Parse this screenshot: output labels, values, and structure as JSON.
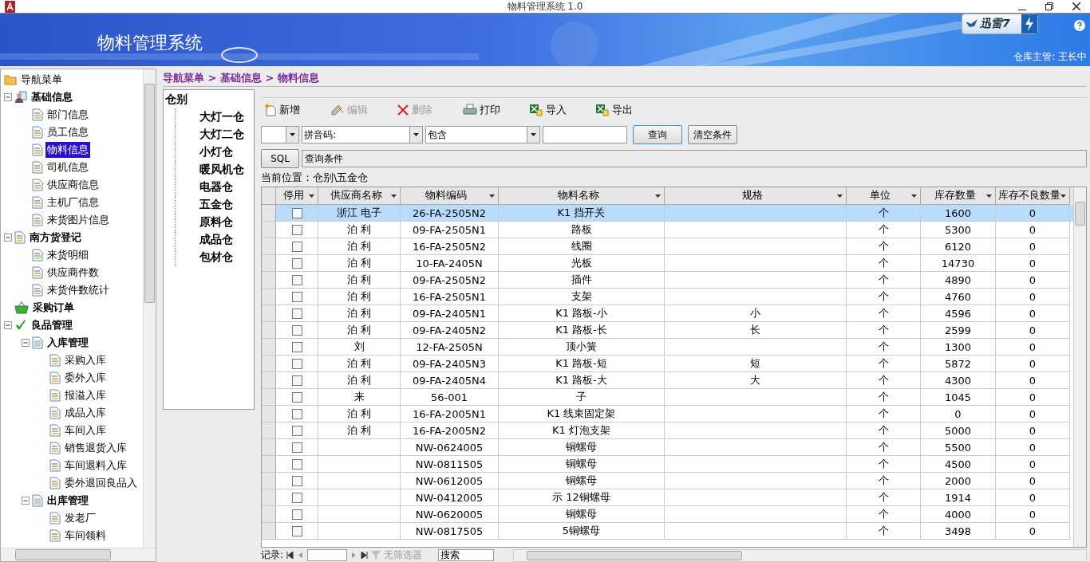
{
  "window": {
    "title": "物料管理系统 1.0"
  },
  "banner": {
    "title": "物料管理系统",
    "badge": "迅雷7",
    "user": "仓库主管: 王长中"
  },
  "nav": {
    "root": "导航菜单",
    "items": [
      {
        "label": "基础信息",
        "kind": "person",
        "expanded": true,
        "selected": false,
        "children": [
          {
            "label": "部门信息",
            "kind": "page",
            "selected": false
          },
          {
            "label": "员工信息",
            "kind": "page",
            "selected": false
          },
          {
            "label": "物料信息",
            "kind": "page",
            "selected": true
          },
          {
            "label": "司机信息",
            "kind": "page",
            "selected": false
          },
          {
            "label": "供应商信息",
            "kind": "page",
            "selected": false
          },
          {
            "label": "主机厂信息",
            "kind": "page",
            "selected": false
          },
          {
            "label": "来货图片信息",
            "kind": "page",
            "selected": false
          }
        ]
      },
      {
        "label": "南方货登记",
        "kind": "register",
        "expanded": true,
        "selected": false,
        "children": [
          {
            "label": "来货明细",
            "kind": "page",
            "selected": false
          },
          {
            "label": "供应商件数",
            "kind": "page",
            "selected": false
          },
          {
            "label": "来货件数统计",
            "kind": "page",
            "selected": false
          }
        ]
      },
      {
        "label": "采购订单",
        "kind": "basket",
        "selected": false
      },
      {
        "label": "良品管理",
        "kind": "check",
        "expanded": true,
        "selected": false,
        "children": [
          {
            "label": "入库管理",
            "kind": "sheet",
            "expanded": true,
            "selected": false,
            "children": [
              {
                "label": "采购入库",
                "kind": "page",
                "selected": false
              },
              {
                "label": "委外入库",
                "kind": "page",
                "selected": false
              },
              {
                "label": "报溢入库",
                "kind": "page",
                "selected": false
              },
              {
                "label": "成品入库",
                "kind": "page",
                "selected": false
              },
              {
                "label": "车间入库",
                "kind": "page",
                "selected": false
              },
              {
                "label": "销售退货入库",
                "kind": "page",
                "selected": false
              },
              {
                "label": "车间退料入库",
                "kind": "page",
                "selected": false
              },
              {
                "label": "委外退回良品入",
                "kind": "page",
                "selected": false
              }
            ]
          },
          {
            "label": "出库管理",
            "kind": "sheet",
            "expanded": true,
            "selected": false,
            "children": [
              {
                "label": "发老厂",
                "kind": "page",
                "selected": false
              },
              {
                "label": "车间领料",
                "kind": "page",
                "selected": false
              }
            ]
          }
        ]
      }
    ]
  },
  "breadcrumb": "导航菜单 > 基础信息 > 物料信息",
  "warehouses": {
    "root": "仓别",
    "items": [
      "大灯一仓",
      "大灯二仓",
      "小灯仓",
      "暖风机仓",
      "电器仓",
      "五金仓",
      "原料仓",
      "成品仓",
      "包材仓"
    ]
  },
  "toolbar": [
    {
      "label": "新增",
      "kind": "new",
      "disabled": false
    },
    {
      "label": "编辑",
      "kind": "edit",
      "disabled": true
    },
    {
      "label": "删除",
      "kind": "delete",
      "disabled": true
    },
    {
      "label": "打印",
      "kind": "print",
      "disabled": false
    },
    {
      "label": "导入",
      "kind": "excel",
      "disabled": false
    },
    {
      "label": "导出",
      "kind": "excel",
      "disabled": false
    }
  ],
  "filter": {
    "field": "拼音码:",
    "operator": "包含",
    "search_button": "查询",
    "clear_button": "清空条件",
    "sql_button": "SQL",
    "condition": "查询条件"
  },
  "location": "当前位置：仓别\\五金仓",
  "table": {
    "columns": [
      "停用",
      "供应商名称",
      "物料编码",
      "物料名称",
      "规格",
      "单位",
      "库存数量",
      "库存不良数量"
    ],
    "rows": [
      {
        "stopped": false,
        "selected": true,
        "supplier": "浙江 电子",
        "code": "26-FA-2505N2",
        "name": "K1 挡开关",
        "unit": "个",
        "qty": "1600",
        "bad": "0"
      },
      {
        "stopped": false,
        "selected": false,
        "supplier": "泊 利",
        "code": "09-FA-2505N1",
        "name": "路板",
        "unit": "个",
        "qty": "5300",
        "bad": "0"
      },
      {
        "stopped": false,
        "selected": false,
        "supplier": "泊 利",
        "code": "16-FA-2505N2",
        "name": "线圈",
        "unit": "个",
        "qty": "6120",
        "bad": "0"
      },
      {
        "stopped": false,
        "selected": false,
        "supplier": "泊 利",
        "code": "10-FA-2405N",
        "name": "光板",
        "unit": "个",
        "qty": "14730",
        "bad": "0"
      },
      {
        "stopped": false,
        "selected": false,
        "supplier": "泊 利",
        "code": "09-FA-2505N2",
        "name": "插件",
        "unit": "个",
        "qty": "4890",
        "bad": "0"
      },
      {
        "stopped": false,
        "selected": false,
        "supplier": "泊 利",
        "code": "16-FA-2505N1",
        "name": "支架",
        "unit": "个",
        "qty": "4760",
        "bad": "0"
      },
      {
        "stopped": false,
        "selected": false,
        "supplier": "泊 利",
        "code": "09-FA-2405N1",
        "name": "K1 路板-小",
        "spec": "小",
        "unit": "个",
        "qty": "4596",
        "bad": "0"
      },
      {
        "stopped": false,
        "selected": false,
        "supplier": "泊 利",
        "code": "09-FA-2405N2",
        "name": "K1 路板-长",
        "spec": "长",
        "unit": "个",
        "qty": "2599",
        "bad": "0"
      },
      {
        "stopped": false,
        "selected": false,
        "supplier": "刘",
        "code": "12-FA-2505N",
        "name": "顶小簧",
        "unit": "个",
        "qty": "1300",
        "bad": "0"
      },
      {
        "stopped": false,
        "selected": false,
        "supplier": "泊 利",
        "code": "09-FA-2405N3",
        "name": "K1 路板-短",
        "spec": "短",
        "unit": "个",
        "qty": "5872",
        "bad": "0"
      },
      {
        "stopped": false,
        "selected": false,
        "supplier": "泊 利",
        "code": "09-FA-2405N4",
        "name": "K1 路板-大",
        "spec": "大",
        "unit": "个",
        "qty": "4300",
        "bad": "0"
      },
      {
        "stopped": false,
        "selected": false,
        "supplier": "来",
        "code": "56-001",
        "name": "子",
        "unit": "个",
        "qty": "1045",
        "bad": "0"
      },
      {
        "stopped": false,
        "selected": false,
        "supplier": "泊 利",
        "code": "16-FA-2005N1",
        "name": "K1 线束固定架",
        "unit": "个",
        "qty": "0",
        "bad": "0"
      },
      {
        "stopped": false,
        "selected": false,
        "supplier": "泊 利",
        "code": "16-FA-2005N2",
        "name": "K1 灯泡支架",
        "unit": "个",
        "qty": "5000",
        "bad": "0"
      },
      {
        "stopped": false,
        "selected": false,
        "code": "NW-0624005",
        "name": "铜螺母",
        "unit": "个",
        "qty": "5500",
        "bad": "0"
      },
      {
        "stopped": false,
        "selected": false,
        "code": "NW-0811505",
        "name": "铜螺母",
        "unit": "个",
        "qty": "4500",
        "bad": "0"
      },
      {
        "stopped": false,
        "selected": false,
        "code": "NW-0612005",
        "name": "铜螺母",
        "unit": "个",
        "qty": "2000",
        "bad": "0"
      },
      {
        "stopped": false,
        "selected": false,
        "code": "NW-0412005",
        "name": "示 12铜螺母",
        "unit": "个",
        "qty": "1914",
        "bad": "0"
      },
      {
        "stopped": false,
        "selected": false,
        "code": "NW-0620005",
        "name": "铜螺母",
        "unit": "个",
        "qty": "4000",
        "bad": "0"
      },
      {
        "stopped": false,
        "selected": false,
        "code": "NW-0817505",
        "name": "5铜螺母",
        "unit": "个",
        "qty": "3498",
        "bad": "0"
      }
    ]
  },
  "record_nav": {
    "label": "记录:",
    "filter": "无筛选器",
    "search": "搜索"
  }
}
